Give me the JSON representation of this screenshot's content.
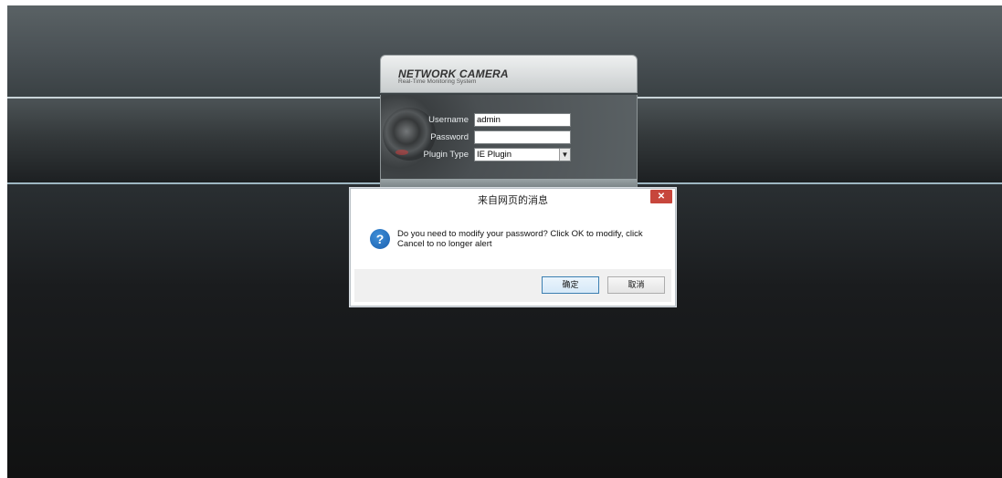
{
  "login": {
    "brand_title": "NETWORK CAMERA",
    "brand_subtitle": "Real-Time Monitoring System",
    "username_label": "Username",
    "username_value": "admin",
    "password_label": "Password",
    "password_value": "",
    "plugin_label": "Plugin Type",
    "plugin_value": "IE Plugin"
  },
  "dialog": {
    "title": "来自网页的消息",
    "close_glyph": "✕",
    "icon_glyph": "?",
    "message": "Do you need to modify your password? Click OK to modify, click Cancel to no longer alert",
    "ok_label": "确定",
    "cancel_label": "取消"
  },
  "colors": {
    "dialog_close": "#c7463c",
    "question_icon": "#1a5fae",
    "separator": "#c9d4d8"
  }
}
